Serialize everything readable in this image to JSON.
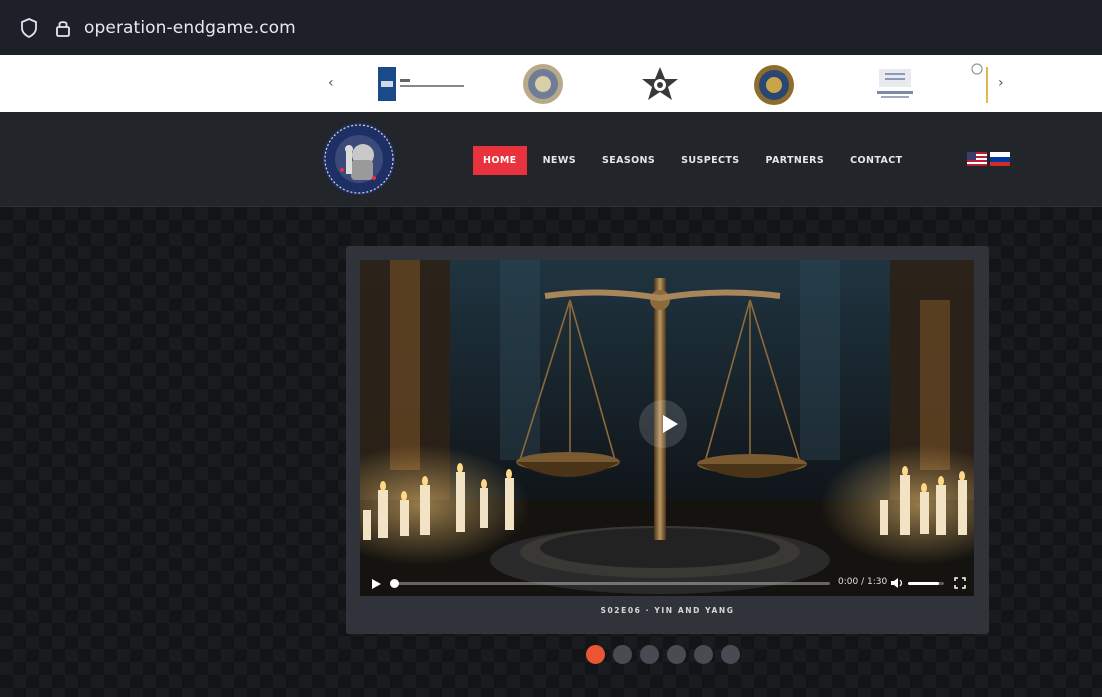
{
  "browser": {
    "url": "operation-endgame.com"
  },
  "partners_strip": {
    "prev_arrow": "‹",
    "next_arrow": "›",
    "logos": [
      "nla-logo",
      "police-seal-logo",
      "star-badge-logo",
      "federal-seal-logo",
      "eurojust-logo",
      "partial-logo"
    ]
  },
  "nav": {
    "items": [
      {
        "label": "HOME",
        "active": true
      },
      {
        "label": "NEWS",
        "active": false
      },
      {
        "label": "SEASONS",
        "active": false
      },
      {
        "label": "SUSPECTS",
        "active": false
      },
      {
        "label": "PARTNERS",
        "active": false
      },
      {
        "label": "CONTACT",
        "active": false
      }
    ],
    "flags": [
      "us-flag",
      "ru-flag"
    ],
    "accent_color": "#e8323d"
  },
  "video": {
    "time": "0:00 / 1:30",
    "caption": "S02E06 · YIN AND YANG",
    "progress": 0.0,
    "volume": 0.85
  },
  "carousel": {
    "count": 6,
    "active_index": 0,
    "active_color": "#ec5533"
  }
}
